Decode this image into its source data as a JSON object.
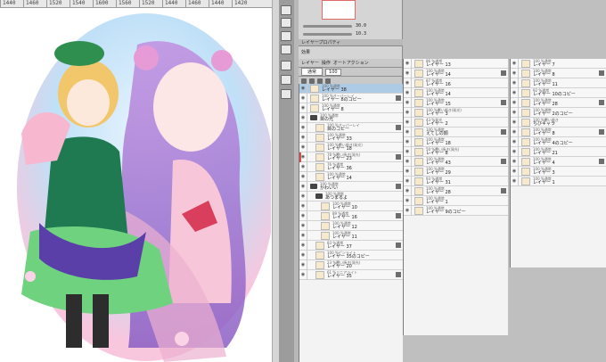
{
  "ruler": {
    "ticks": [
      "1440",
      "1460",
      "1520",
      "1540",
      "1600",
      "1560",
      "1520",
      "1440",
      "1460",
      "1440",
      "1420"
    ]
  },
  "properties": {
    "tab_label": "ツール",
    "opacity_value": "30.0",
    "size_value": "10.3",
    "layer_prop_tab": "レイヤープロパティ",
    "effect_label": "効果"
  },
  "layer_panel": {
    "tabs": [
      "レイヤー",
      "操作",
      "オートアクション"
    ],
    "blend_mode": "通常",
    "opacity": "100"
  },
  "col1": [
    {
      "mode": "100 %通常",
      "name": "レイヤー 38",
      "sel": true,
      "kind": "line"
    },
    {
      "mode": "100 %オーバーレイ",
      "name": "レイヤー 8のコピー",
      "kind": "thumb"
    },
    {
      "mode": "100 %通常",
      "name": "レイヤー 8",
      "kind": "thumb"
    },
    {
      "mode": "100 %通常",
      "name": "目の光",
      "kind": "folder"
    },
    {
      "mode": "100 %オーバーレイ",
      "name": "目のコピー",
      "kind": "thumb",
      "indent": 1
    },
    {
      "mode": "100 %通常",
      "name": "レイヤー 33",
      "kind": "thumb",
      "indent": 1
    },
    {
      "mode": "100 %覆い焼き(発光)",
      "name": "レイヤー 18",
      "kind": "thumb",
      "indent": 1
    },
    {
      "mode": "78 %覆い焼き(発光)",
      "name": "レイヤー 23",
      "kind": "thumb",
      "indent": 1,
      "bar": "#d94d4d"
    },
    {
      "mode": "76 %通常",
      "name": "レイヤー 36",
      "kind": "thumb",
      "indent": 1
    },
    {
      "mode": "100 %通常",
      "name": "レイヤー 14",
      "kind": "thumb",
      "indent": 1
    },
    {
      "mode": "100 %通常",
      "name": "かわいい",
      "kind": "folder"
    },
    {
      "mode": "100 %通常",
      "name": "あつまるよ",
      "kind": "folder",
      "indent": 1
    },
    {
      "mode": "100 %通常",
      "name": "レイヤー 10",
      "kind": "thumb",
      "indent": 2
    },
    {
      "mode": "89 %通常",
      "name": "レイヤー 16",
      "kind": "thumb",
      "indent": 2
    },
    {
      "mode": "100 %通常",
      "name": "レイヤー 12",
      "kind": "thumb",
      "indent": 2
    },
    {
      "mode": "100 %通常",
      "name": "レイヤー 11",
      "kind": "thumb",
      "indent": 2
    },
    {
      "mode": "83 %通常",
      "name": "レイヤー 37",
      "kind": "thumb",
      "indent": 1
    },
    {
      "mode": "100 %ピンライト",
      "name": "レイヤー 35のコピー",
      "kind": "thumb",
      "indent": 1
    },
    {
      "mode": "23 %覆い焼き(発光)",
      "name": "レイヤー 20",
      "kind": "thumb",
      "indent": 1
    },
    {
      "mode": "61 %リニアライト",
      "name": "レイヤー 35",
      "kind": "thumb",
      "indent": 1
    }
  ],
  "col2": [
    {
      "mode": "86 %通常",
      "name": "レイヤー 13"
    },
    {
      "mode": "100 %通常",
      "name": "レイヤー 14"
    },
    {
      "mode": "87 %通常",
      "name": "レイヤー 16"
    },
    {
      "mode": "100 %通常",
      "name": "レイヤー 14"
    },
    {
      "mode": "100 %通常",
      "name": "レイヤー 15"
    },
    {
      "mode": "100 %覆い焼き(発光)",
      "name": "レイヤー 3"
    },
    {
      "mode": "43 %発光",
      "name": "レイヤー 2"
    },
    {
      "mode": "100 %通常",
      "name": "えてしの顔"
    },
    {
      "mode": "100 %通常",
      "name": "レイヤー 18"
    },
    {
      "mode": "50 %覆い焼き(発光)",
      "name": "レイヤー 8"
    },
    {
      "mode": "100 %通常",
      "name": "レイヤー 43"
    },
    {
      "mode": "100 %通常",
      "name": "レイヤー 29"
    },
    {
      "mode": "93 %通常",
      "name": "レイヤー 31"
    },
    {
      "mode": "100 %通常",
      "name": "レイヤー 28"
    },
    {
      "mode": "100 %通常",
      "name": "レイヤー 1"
    },
    {
      "mode": "100 %通常",
      "name": "レイヤー 9のコピー"
    }
  ],
  "col3": [
    {
      "mode": "100 %通常",
      "name": "レイヤー 7"
    },
    {
      "mode": "100 %通常",
      "name": "レイヤー 8"
    },
    {
      "mode": "100 %通常",
      "name": "レイヤー 11"
    },
    {
      "mode": "92 %通常",
      "name": "レイヤー 10のコピー"
    },
    {
      "mode": "100 %通常",
      "name": "レイヤー 28"
    },
    {
      "mode": "100 %通常",
      "name": "レイヤー 2のコピー"
    },
    {
      "mode": "100 %覆い焼き",
      "name": "ちびキャラ"
    },
    {
      "mode": "100 %通常",
      "name": "レイヤー 8"
    },
    {
      "mode": "100 %通常",
      "name": "レイヤー 4のコピー"
    },
    {
      "mode": "100 %通常",
      "name": "レイヤー 21"
    },
    {
      "mode": "100 %通常",
      "name": "レイヤー 4"
    },
    {
      "mode": "100 %通常",
      "name": "レイヤー 3"
    },
    {
      "mode": "100 %通常",
      "name": "レイヤー 1"
    }
  ]
}
